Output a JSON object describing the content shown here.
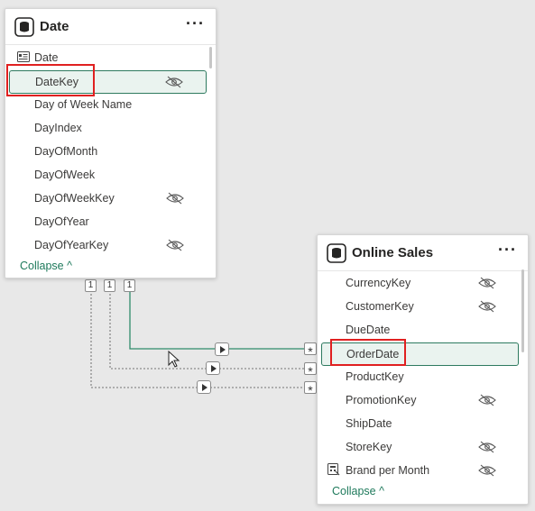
{
  "colors": {
    "accent": "#1f7a5c",
    "selected_border": "#2e7a5f",
    "highlight_box": "#e02020",
    "active_relationship": "#2e8b6a",
    "inactive_relationship": "#8a8a8a"
  },
  "date_table": {
    "title": "Date",
    "menu_label": "···",
    "fields": [
      {
        "name": "Date",
        "icon": "calendar-field-icon",
        "hidden": false
      },
      {
        "name": "DateKey",
        "hidden": true,
        "selected": true
      },
      {
        "name": "Day of Week Name",
        "hidden": false
      },
      {
        "name": "DayIndex",
        "hidden": false
      },
      {
        "name": "DayOfMonth",
        "hidden": false
      },
      {
        "name": "DayOfWeek",
        "hidden": false
      },
      {
        "name": "DayOfWeekKey",
        "hidden": true
      },
      {
        "name": "DayOfYear",
        "hidden": false
      },
      {
        "name": "DayOfYearKey",
        "hidden": true
      }
    ],
    "collapse_label": "Collapse ^"
  },
  "sales_table": {
    "title": "Online Sales",
    "menu_label": "···",
    "fields": [
      {
        "name": "CurrencyKey",
        "hidden": true
      },
      {
        "name": "CustomerKey",
        "hidden": true
      },
      {
        "name": "DueDate",
        "hidden": false
      },
      {
        "name": "OrderDate",
        "hidden": false,
        "selected": true
      },
      {
        "name": "ProductKey",
        "hidden": false
      },
      {
        "name": "PromotionKey",
        "hidden": true
      },
      {
        "name": "ShipDate",
        "hidden": false
      },
      {
        "name": "StoreKey",
        "hidden": true
      },
      {
        "name": "Brand per Month",
        "icon": "measure-icon",
        "hidden": true
      }
    ],
    "collapse_label": "Collapse ^"
  },
  "relationships": [
    {
      "from_cardinality": "1",
      "to_cardinality": "*",
      "active": true,
      "from": "DateKey",
      "to": "OrderDate"
    },
    {
      "from_cardinality": "1",
      "to_cardinality": "*",
      "active": false
    },
    {
      "from_cardinality": "1",
      "to_cardinality": "*",
      "active": false
    }
  ]
}
